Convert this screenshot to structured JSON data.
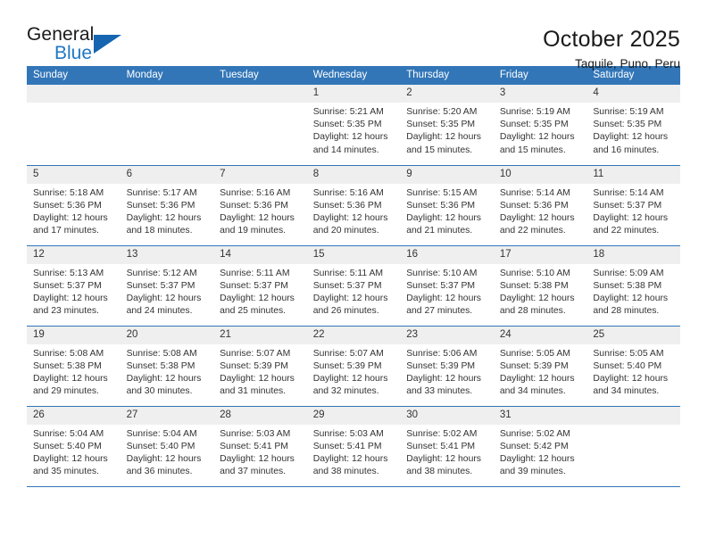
{
  "brand": {
    "name_part1": "General",
    "name_part2": "Blue",
    "flag_icon": "flag-triangle-icon",
    "accent_color": "#1f77c4"
  },
  "header": {
    "title": "October 2025",
    "subtitle": "Taquile, Puno, Peru"
  },
  "theme": {
    "header_bar_color": "#3276b8",
    "daynum_band_color": "#efefef",
    "row_rule_color": "#3276b8",
    "text_color": "#333333"
  },
  "weekday_headers": [
    "Sunday",
    "Monday",
    "Tuesday",
    "Wednesday",
    "Thursday",
    "Friday",
    "Saturday"
  ],
  "labels": {
    "sunrise_prefix": "Sunrise:",
    "sunset_prefix": "Sunset:",
    "daylight_prefix": "Daylight:"
  },
  "weeks": [
    [
      {
        "day": "",
        "empty": true
      },
      {
        "day": "",
        "empty": true
      },
      {
        "day": "",
        "empty": true
      },
      {
        "day": "1",
        "sunrise": "Sunrise: 5:21 AM",
        "sunset": "Sunset: 5:35 PM",
        "daylight_l1": "Daylight: 12 hours",
        "daylight_l2": "and 14 minutes."
      },
      {
        "day": "2",
        "sunrise": "Sunrise: 5:20 AM",
        "sunset": "Sunset: 5:35 PM",
        "daylight_l1": "Daylight: 12 hours",
        "daylight_l2": "and 15 minutes."
      },
      {
        "day": "3",
        "sunrise": "Sunrise: 5:19 AM",
        "sunset": "Sunset: 5:35 PM",
        "daylight_l1": "Daylight: 12 hours",
        "daylight_l2": "and 15 minutes."
      },
      {
        "day": "4",
        "sunrise": "Sunrise: 5:19 AM",
        "sunset": "Sunset: 5:35 PM",
        "daylight_l1": "Daylight: 12 hours",
        "daylight_l2": "and 16 minutes."
      }
    ],
    [
      {
        "day": "5",
        "sunrise": "Sunrise: 5:18 AM",
        "sunset": "Sunset: 5:36 PM",
        "daylight_l1": "Daylight: 12 hours",
        "daylight_l2": "and 17 minutes."
      },
      {
        "day": "6",
        "sunrise": "Sunrise: 5:17 AM",
        "sunset": "Sunset: 5:36 PM",
        "daylight_l1": "Daylight: 12 hours",
        "daylight_l2": "and 18 minutes."
      },
      {
        "day": "7",
        "sunrise": "Sunrise: 5:16 AM",
        "sunset": "Sunset: 5:36 PM",
        "daylight_l1": "Daylight: 12 hours",
        "daylight_l2": "and 19 minutes."
      },
      {
        "day": "8",
        "sunrise": "Sunrise: 5:16 AM",
        "sunset": "Sunset: 5:36 PM",
        "daylight_l1": "Daylight: 12 hours",
        "daylight_l2": "and 20 minutes."
      },
      {
        "day": "9",
        "sunrise": "Sunrise: 5:15 AM",
        "sunset": "Sunset: 5:36 PM",
        "daylight_l1": "Daylight: 12 hours",
        "daylight_l2": "and 21 minutes."
      },
      {
        "day": "10",
        "sunrise": "Sunrise: 5:14 AM",
        "sunset": "Sunset: 5:36 PM",
        "daylight_l1": "Daylight: 12 hours",
        "daylight_l2": "and 22 minutes."
      },
      {
        "day": "11",
        "sunrise": "Sunrise: 5:14 AM",
        "sunset": "Sunset: 5:37 PM",
        "daylight_l1": "Daylight: 12 hours",
        "daylight_l2": "and 22 minutes."
      }
    ],
    [
      {
        "day": "12",
        "sunrise": "Sunrise: 5:13 AM",
        "sunset": "Sunset: 5:37 PM",
        "daylight_l1": "Daylight: 12 hours",
        "daylight_l2": "and 23 minutes."
      },
      {
        "day": "13",
        "sunrise": "Sunrise: 5:12 AM",
        "sunset": "Sunset: 5:37 PM",
        "daylight_l1": "Daylight: 12 hours",
        "daylight_l2": "and 24 minutes."
      },
      {
        "day": "14",
        "sunrise": "Sunrise: 5:11 AM",
        "sunset": "Sunset: 5:37 PM",
        "daylight_l1": "Daylight: 12 hours",
        "daylight_l2": "and 25 minutes."
      },
      {
        "day": "15",
        "sunrise": "Sunrise: 5:11 AM",
        "sunset": "Sunset: 5:37 PM",
        "daylight_l1": "Daylight: 12 hours",
        "daylight_l2": "and 26 minutes."
      },
      {
        "day": "16",
        "sunrise": "Sunrise: 5:10 AM",
        "sunset": "Sunset: 5:37 PM",
        "daylight_l1": "Daylight: 12 hours",
        "daylight_l2": "and 27 minutes."
      },
      {
        "day": "17",
        "sunrise": "Sunrise: 5:10 AM",
        "sunset": "Sunset: 5:38 PM",
        "daylight_l1": "Daylight: 12 hours",
        "daylight_l2": "and 28 minutes."
      },
      {
        "day": "18",
        "sunrise": "Sunrise: 5:09 AM",
        "sunset": "Sunset: 5:38 PM",
        "daylight_l1": "Daylight: 12 hours",
        "daylight_l2": "and 28 minutes."
      }
    ],
    [
      {
        "day": "19",
        "sunrise": "Sunrise: 5:08 AM",
        "sunset": "Sunset: 5:38 PM",
        "daylight_l1": "Daylight: 12 hours",
        "daylight_l2": "and 29 minutes."
      },
      {
        "day": "20",
        "sunrise": "Sunrise: 5:08 AM",
        "sunset": "Sunset: 5:38 PM",
        "daylight_l1": "Daylight: 12 hours",
        "daylight_l2": "and 30 minutes."
      },
      {
        "day": "21",
        "sunrise": "Sunrise: 5:07 AM",
        "sunset": "Sunset: 5:39 PM",
        "daylight_l1": "Daylight: 12 hours",
        "daylight_l2": "and 31 minutes."
      },
      {
        "day": "22",
        "sunrise": "Sunrise: 5:07 AM",
        "sunset": "Sunset: 5:39 PM",
        "daylight_l1": "Daylight: 12 hours",
        "daylight_l2": "and 32 minutes."
      },
      {
        "day": "23",
        "sunrise": "Sunrise: 5:06 AM",
        "sunset": "Sunset: 5:39 PM",
        "daylight_l1": "Daylight: 12 hours",
        "daylight_l2": "and 33 minutes."
      },
      {
        "day": "24",
        "sunrise": "Sunrise: 5:05 AM",
        "sunset": "Sunset: 5:39 PM",
        "daylight_l1": "Daylight: 12 hours",
        "daylight_l2": "and 34 minutes."
      },
      {
        "day": "25",
        "sunrise": "Sunrise: 5:05 AM",
        "sunset": "Sunset: 5:40 PM",
        "daylight_l1": "Daylight: 12 hours",
        "daylight_l2": "and 34 minutes."
      }
    ],
    [
      {
        "day": "26",
        "sunrise": "Sunrise: 5:04 AM",
        "sunset": "Sunset: 5:40 PM",
        "daylight_l1": "Daylight: 12 hours",
        "daylight_l2": "and 35 minutes."
      },
      {
        "day": "27",
        "sunrise": "Sunrise: 5:04 AM",
        "sunset": "Sunset: 5:40 PM",
        "daylight_l1": "Daylight: 12 hours",
        "daylight_l2": "and 36 minutes."
      },
      {
        "day": "28",
        "sunrise": "Sunrise: 5:03 AM",
        "sunset": "Sunset: 5:41 PM",
        "daylight_l1": "Daylight: 12 hours",
        "daylight_l2": "and 37 minutes."
      },
      {
        "day": "29",
        "sunrise": "Sunrise: 5:03 AM",
        "sunset": "Sunset: 5:41 PM",
        "daylight_l1": "Daylight: 12 hours",
        "daylight_l2": "and 38 minutes."
      },
      {
        "day": "30",
        "sunrise": "Sunrise: 5:02 AM",
        "sunset": "Sunset: 5:41 PM",
        "daylight_l1": "Daylight: 12 hours",
        "daylight_l2": "and 38 minutes."
      },
      {
        "day": "31",
        "sunrise": "Sunrise: 5:02 AM",
        "sunset": "Sunset: 5:42 PM",
        "daylight_l1": "Daylight: 12 hours",
        "daylight_l2": "and 39 minutes."
      },
      {
        "day": "",
        "empty": true
      }
    ]
  ]
}
